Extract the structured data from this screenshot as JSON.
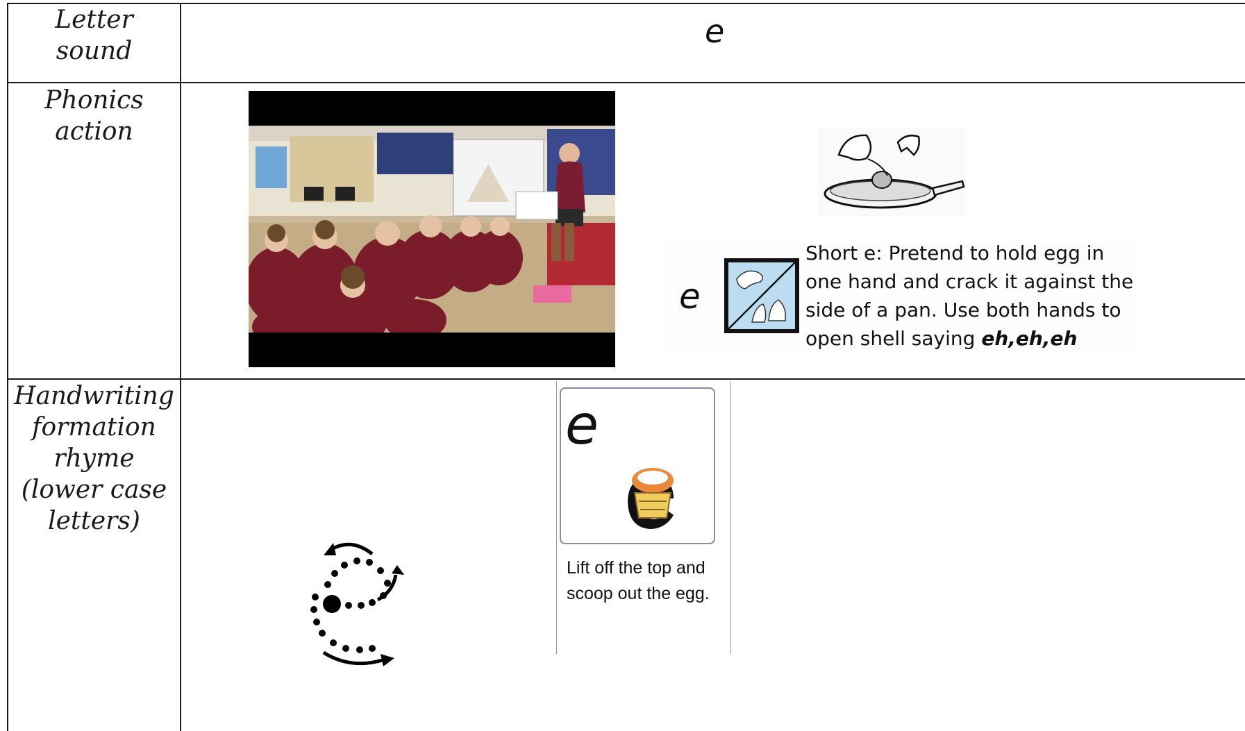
{
  "rows": [
    {
      "label_lines": [
        "Letter",
        "sound"
      ]
    },
    {
      "label_lines": [
        "Phonics",
        "action"
      ]
    },
    {
      "label_lines": [
        "Handwriting",
        "formation",
        "rhyme",
        "(lower case",
        "letters)"
      ]
    }
  ],
  "letter_sound": {
    "letter": "e"
  },
  "phonics_action": {
    "video_label": "classroom-video",
    "card_letter": "e",
    "description": "Short e: Pretend to hold egg in one hand and crack it against the side of a pan. Use both hands to open shell saying",
    "sound_text": "eh,eh,eh"
  },
  "handwriting": {
    "card_letter": "e",
    "rhyme_text": "Lift off the top and scoop out the egg."
  },
  "colors": {
    "grid": "#1a1a1a",
    "icon_bg": "#bcdcf2",
    "card_border": "#8c8aa0"
  },
  "icons": [
    "egg-in-pan-icon",
    "hands-cracking-egg-icon",
    "formation-arrows-icon",
    "egg-letter-icon"
  ]
}
